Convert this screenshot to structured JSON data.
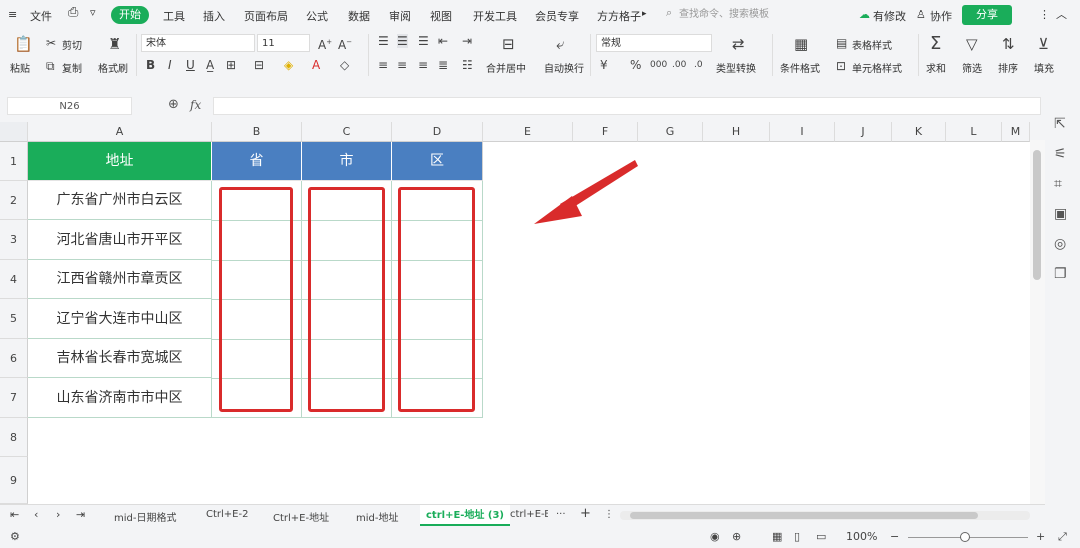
{
  "menu": {
    "hamburger_icon": "≡",
    "file": "文件",
    "start": "开始",
    "items": [
      "工具",
      "插入",
      "页面布局",
      "公式",
      "数据",
      "审阅",
      "视图",
      "开发工具",
      "会员专享",
      "方方格子"
    ],
    "search_placeholder": "查找命令、搜索模板",
    "modified": "有修改",
    "collab": "协作",
    "share": "分享"
  },
  "ribbon": {
    "paste": "粘贴",
    "cut": "剪切",
    "copy": "复制",
    "format_painter": "格式刷",
    "font_name": "宋体",
    "font_size": "11",
    "merge_center": "合并居中",
    "wrap_text": "自动换行",
    "number_format": "常规",
    "type_convert": "类型转换",
    "conditional_format": "条件格式",
    "table_style": "表格样式",
    "cell_style": "单元格样式",
    "sum": "求和",
    "filter": "筛选",
    "sort": "排序",
    "fill": "填充"
  },
  "formula_bar": {
    "cell_ref": "N26",
    "fx": "fx",
    "value": ""
  },
  "grid": {
    "columns": [
      "A",
      "B",
      "C",
      "D",
      "E",
      "F",
      "G",
      "H",
      "I",
      "J",
      "K",
      "L",
      "M"
    ],
    "rows": [
      "1",
      "2",
      "3",
      "4",
      "5",
      "6",
      "7",
      "8",
      "9"
    ],
    "headers": {
      "a": "地址",
      "b": "省",
      "c": "市",
      "d": "区"
    },
    "addresses": [
      "广东省广州市白云区",
      "河北省唐山市开平区",
      "江西省赣州市章贡区",
      "辽宁省大连市中山区",
      "吉林省长春市宽城区",
      "山东省济南市市中区"
    ],
    "colors": {
      "green_header": "#1aad5a",
      "blue_header": "#4a7fc1",
      "annotation": "#d92b2b"
    }
  },
  "sheets": {
    "tabs": [
      "mid-日期格式",
      "Ctrl+E-2",
      "Ctrl+E-地址",
      "mid-地址",
      "ctrl+E-地址 (3)",
      "ctrl+E-B"
    ],
    "active_index": 4,
    "more": "···",
    "add": "+"
  },
  "status": {
    "zoom": "100%",
    "minus": "−",
    "plus": "+"
  }
}
